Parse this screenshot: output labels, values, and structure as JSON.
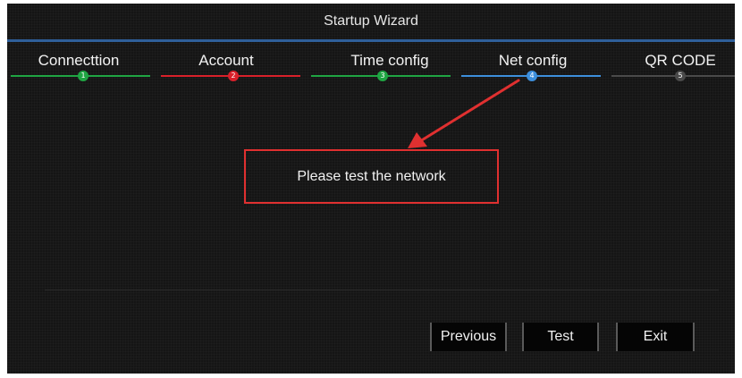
{
  "window": {
    "title": "Startup Wizard"
  },
  "steps": [
    {
      "label": "Connecttion",
      "number": "1",
      "color": "#1fa543"
    },
    {
      "label": "Account",
      "number": "2",
      "color": "#d9202a"
    },
    {
      "label": "Time config",
      "number": "3",
      "color": "#1fa543"
    },
    {
      "label": "Net config",
      "number": "4",
      "color": "#3d8fdc"
    },
    {
      "label": "QR CODE",
      "number": "5",
      "color": "#4a4a4a"
    }
  ],
  "main": {
    "message": "Please test the network"
  },
  "buttons": {
    "previous": "Previous",
    "test": "Test",
    "exit": "Exit"
  },
  "colors": {
    "annotation_red": "#e03030",
    "title_line": "#2f5f9a",
    "background": "#151515"
  }
}
